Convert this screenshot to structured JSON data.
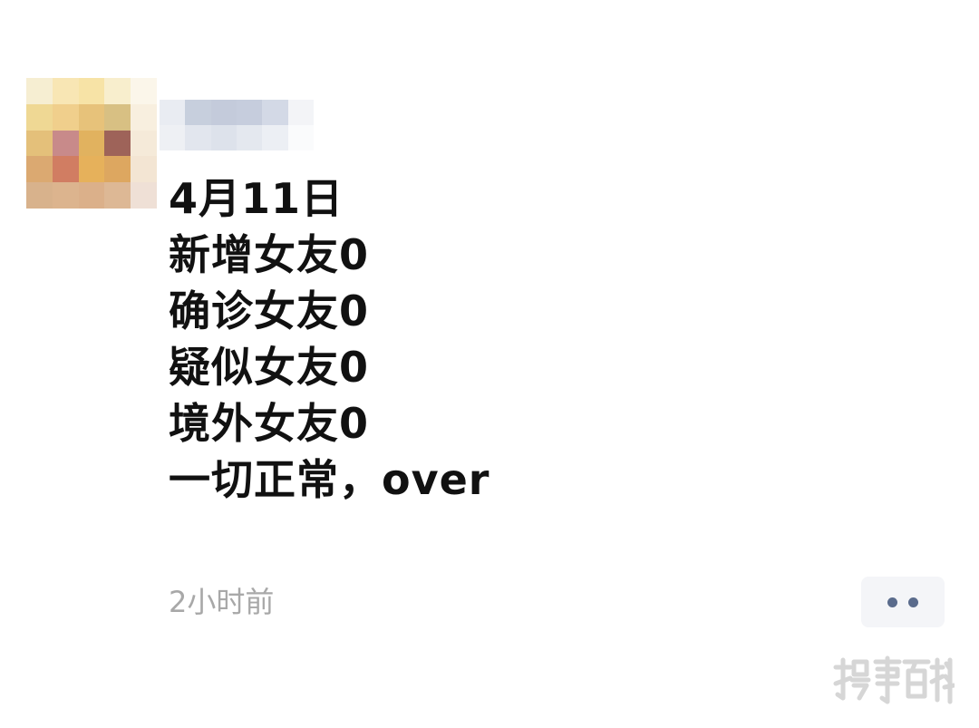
{
  "post": {
    "content_lines": [
      "4月11日",
      "新增女友0",
      "确诊女友0",
      "疑似女友0",
      "境外女友0",
      "一切正常，over"
    ],
    "timestamp": "2小时前"
  },
  "icons": {
    "avatar": "pixelated-avatar",
    "username": "pixelated-username",
    "more": "more-dots-icon",
    "watermark": "watermark-logo"
  },
  "colors": {
    "text": "#111111",
    "timestamp": "#a8a8a8",
    "more_button_bg": "#f4f5f8",
    "more_dots": "#5a6b8c"
  },
  "watermark_text": "搜事百科"
}
